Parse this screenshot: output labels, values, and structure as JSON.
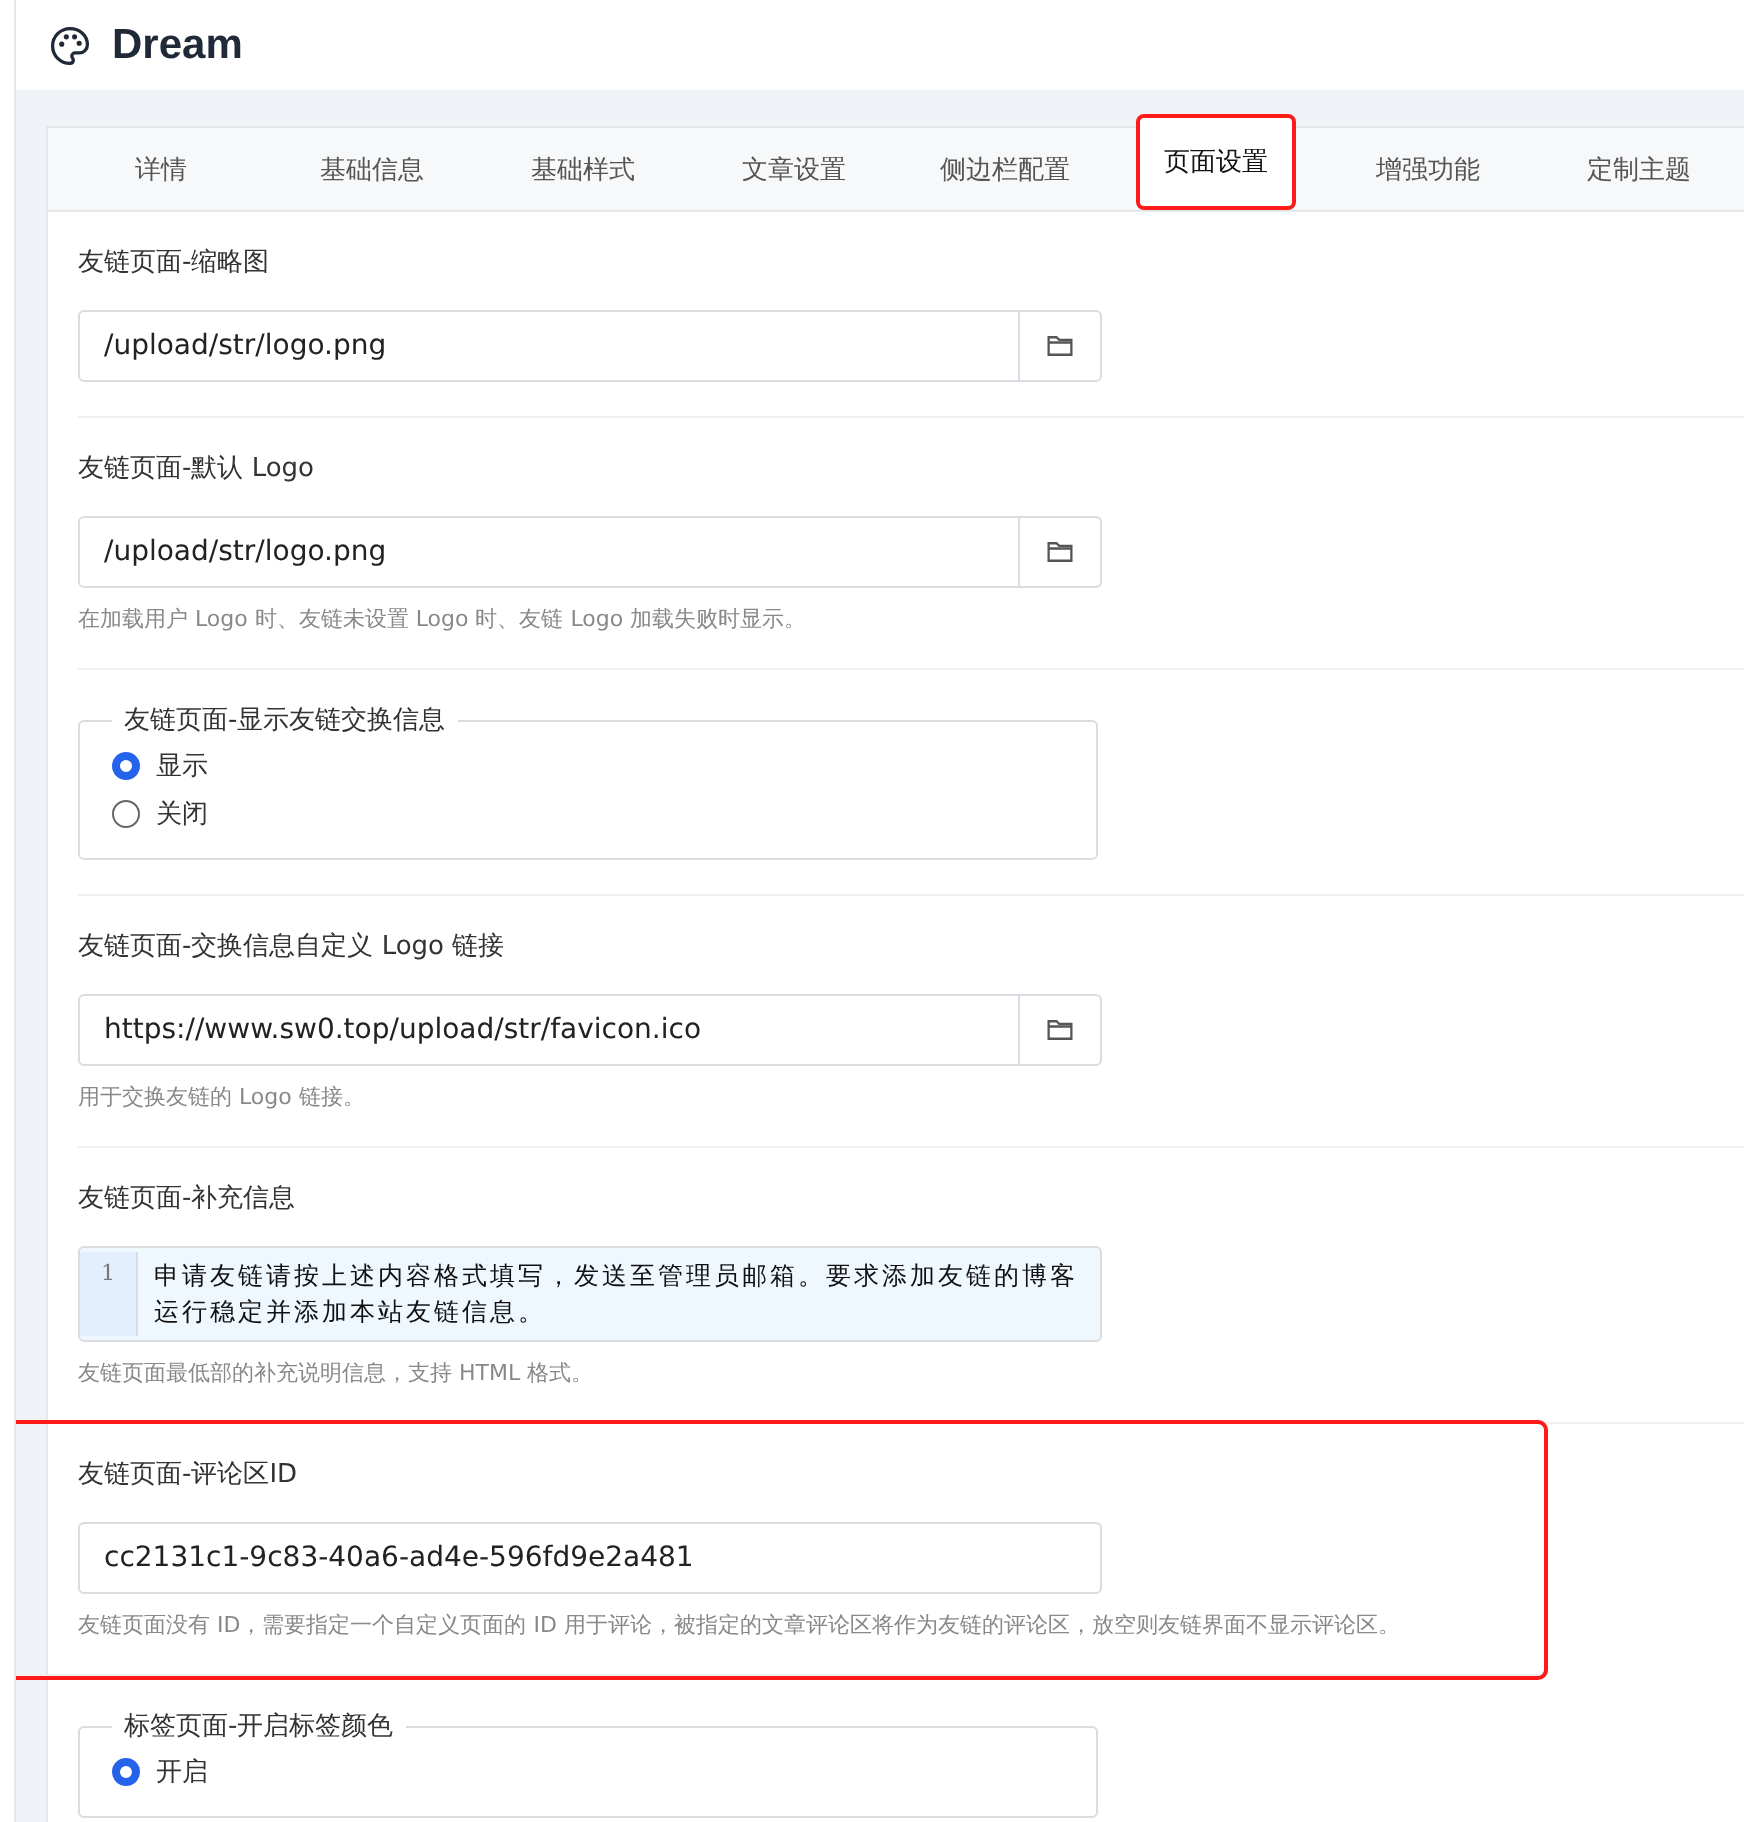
{
  "header": {
    "title": "Dream"
  },
  "tabs": [
    {
      "label": "详情",
      "selected": false,
      "highlighted": false
    },
    {
      "label": "基础信息",
      "selected": false,
      "highlighted": false
    },
    {
      "label": "基础样式",
      "selected": false,
      "highlighted": false
    },
    {
      "label": "文章设置",
      "selected": false,
      "highlighted": false
    },
    {
      "label": "侧边栏配置",
      "selected": false,
      "highlighted": false
    },
    {
      "label": "页面设置",
      "selected": true,
      "highlighted": true
    },
    {
      "label": "增强功能",
      "selected": false,
      "highlighted": false
    },
    {
      "label": "定制主题",
      "selected": false,
      "highlighted": false
    }
  ],
  "sections": [
    {
      "kind": "file",
      "label": "友链页面-缩略图",
      "value": "/upload/str/logo.png",
      "highlighted": false
    },
    {
      "kind": "file",
      "label": "友链页面-默认 Logo",
      "value": "/upload/str/logo.png",
      "hint": "在加载用户 Logo 时、友链未设置 Logo 时、友链 Logo 加载失败时显示。",
      "highlighted": false
    },
    {
      "kind": "radio",
      "label": "友链页面-显示友链交换信息",
      "options": [
        {
          "label": "显示",
          "selected": true
        },
        {
          "label": "关闭",
          "selected": false
        }
      ],
      "highlighted": false
    },
    {
      "kind": "file",
      "label": "友链页面-交换信息自定义 Logo 链接",
      "value": "https://www.sw0.top/upload/str/favicon.ico",
      "hint": "用于交换友链的 Logo 链接。",
      "highlighted": false
    },
    {
      "kind": "code",
      "label": "友链页面-补充信息",
      "lines": [
        {
          "number": "1",
          "text": "申请友链请按上述内容格式填写，发送至管理员邮箱。要求添加友链的博客运行稳定并添加本站友链信息。"
        }
      ],
      "hint": "友链页面最低部的补充说明信息，支持 HTML 格式。",
      "highlighted": false
    },
    {
      "kind": "text",
      "label": "友链页面-评论区ID",
      "value": "cc2131c1-9c83-40a6-ad4e-596fd9e2a481",
      "hint": "友链页面没有 ID，需要指定一个自定义页面的 ID 用于评论，被指定的文章评论区将作为友链的评论区，放空则友链界面不显示评论区。",
      "highlighted": true
    },
    {
      "kind": "radio",
      "label": "标签页面-开启标签颜色",
      "options": [
        {
          "label": "开启",
          "selected": true
        }
      ],
      "highlighted": false
    }
  ]
}
